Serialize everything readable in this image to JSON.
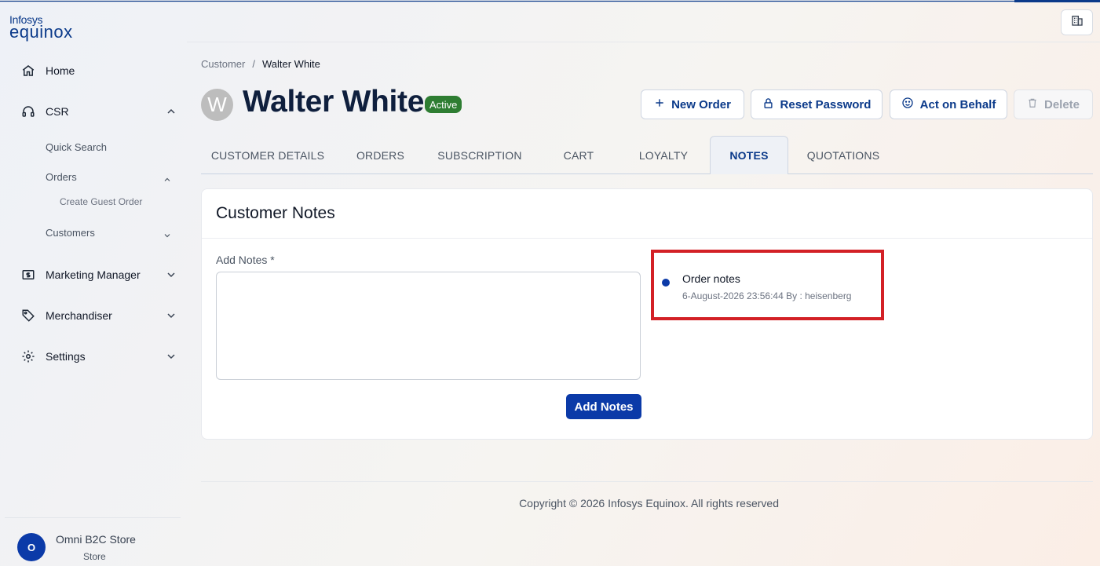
{
  "app": {
    "logo_top": "Infosys",
    "logo_bottom": "equinox"
  },
  "sidebar": {
    "home": "Home",
    "csr": "CSR",
    "quick_search": "Quick Search",
    "orders": "Orders",
    "create_guest_order": "Create Guest Order",
    "customers": "Customers",
    "marketing_manager": "Marketing Manager",
    "merchandiser": "Merchandiser",
    "settings": "Settings",
    "store_initial": "O",
    "store_name": "Omni B2C Store",
    "store_role": "Store"
  },
  "breadcrumb": {
    "parent": "Customer",
    "separator": "/",
    "current": "Walter White"
  },
  "customer": {
    "avatar_initial": "W",
    "name": "Walter White",
    "status": "Active"
  },
  "actions": {
    "new_order": "New Order",
    "reset_password": "Reset Password",
    "act_on_behalf": "Act on Behalf",
    "delete": "Delete"
  },
  "tabs": [
    {
      "label": "CUSTOMER DETAILS",
      "active": false
    },
    {
      "label": "ORDERS",
      "active": false
    },
    {
      "label": "SUBSCRIPTION",
      "active": false
    },
    {
      "label": "CART",
      "active": false
    },
    {
      "label": "LOYALTY",
      "active": false
    },
    {
      "label": "NOTES",
      "active": true
    },
    {
      "label": "QUOTATIONS",
      "active": false
    }
  ],
  "notes_card": {
    "title": "Customer Notes",
    "field_label": "Add Notes *",
    "field_value": "",
    "submit_label": "Add Notes",
    "notes": [
      {
        "title": "Order notes",
        "meta": "6-August-2026 23:56:44 By : heisenberg"
      }
    ]
  },
  "footer": {
    "copyright": "Copyright © 2026 Infosys Equinox. All rights reserved"
  },
  "colors": {
    "brand": "#0b3aa8",
    "active_badge": "#2e7d32",
    "highlight": "#d32026"
  }
}
